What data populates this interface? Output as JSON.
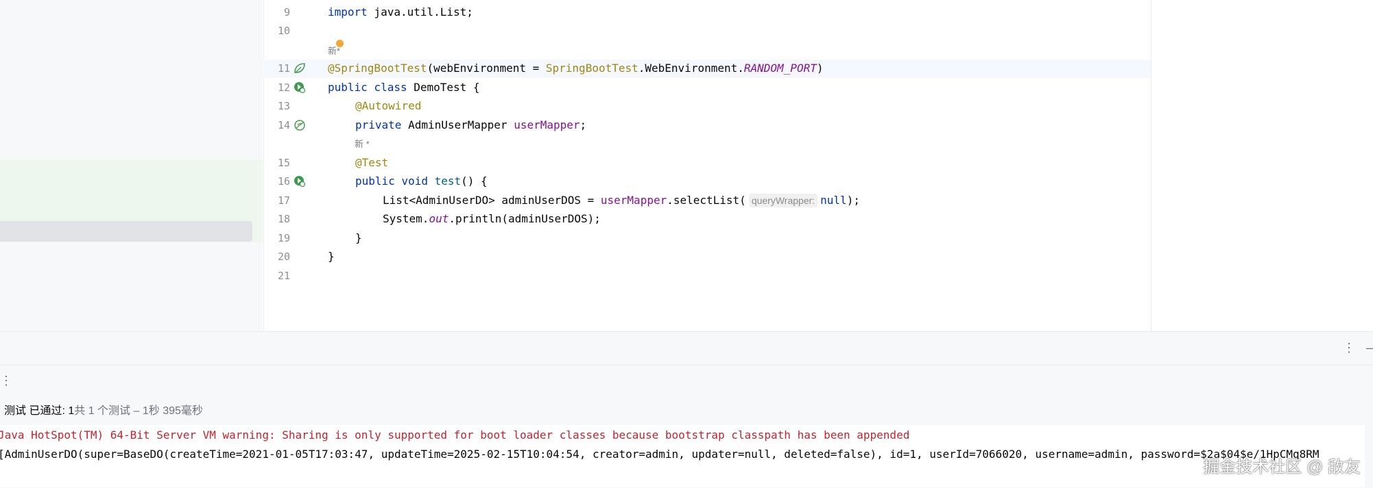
{
  "editor": {
    "line_numbers": [
      "9",
      "10",
      "11",
      "12",
      "13",
      "14",
      "15",
      "16",
      "17",
      "18",
      "19",
      "20",
      "21"
    ],
    "code_lens": [
      "新*",
      "新 *"
    ],
    "lines": {
      "l9": [
        "import",
        " java.util.List;"
      ],
      "l11": [
        "@SpringBootTest",
        "(webEnvironment = ",
        "SpringBootTest",
        ".WebEnvironment.",
        "RANDOM_PORT",
        ")"
      ],
      "l12": [
        "public class",
        " DemoTest {"
      ],
      "l13": [
        "@Autowired"
      ],
      "l14": [
        "private",
        " AdminUserMapper ",
        "userMapper",
        ";"
      ],
      "l15": [
        "@Test"
      ],
      "l16": [
        "public void",
        " ",
        "test",
        "() {"
      ],
      "l17": [
        "List<AdminUserDO> adminUserDOS = ",
        "userMapper",
        ".selectList(",
        "queryWrapper:",
        "null",
        ");"
      ],
      "l18": [
        "System.",
        "out",
        ".println(adminUserDOS);"
      ],
      "l19": [
        "}"
      ],
      "l20": [
        "}"
      ]
    }
  },
  "gutter_icons": [
    "spring-leaf-icon",
    "run-test-icon",
    "bean-icon",
    "run-test-icon"
  ],
  "bottom": {
    "toolbar_icons": [
      "more-options-icon",
      "minimize-icon"
    ],
    "status_prefix": "测试 已通过:",
    "status_count": "1",
    "status_detail": "共 1 个测试 – 1秒 395毫秒",
    "console_lines": [
      "Java HotSpot(TM) 64-Bit Server VM warning: Sharing is only supported for boot loader classes because bootstrap classpath has been appended",
      "[AdminUserDO(super=BaseDO(createTime=2021-01-05T17:03:47, updateTime=2025-02-15T10:04:54, creator=admin, updater=null, deleted=false), id=1, userId=7066020, username=admin, password=$2a$04$e/1HpCMq8RM"
    ],
    "console_colors": {
      "warning": "#c7222d",
      "normal": "#080808"
    }
  },
  "watermark": "掘金技术社区 @ 敌友"
}
